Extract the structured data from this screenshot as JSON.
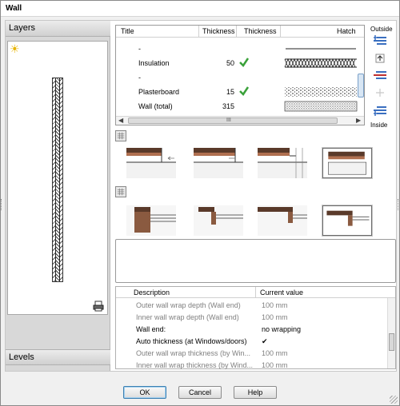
{
  "window": {
    "title": "Wall"
  },
  "left_panel": {
    "layers_header": "Layers",
    "levels_header": "Levels"
  },
  "layer_table": {
    "columns": [
      "Title",
      "Thickness",
      "Thickness",
      "Hatch"
    ],
    "rows": [
      {
        "title": "-",
        "thickness": "",
        "checked": false,
        "hatch": "line"
      },
      {
        "title": "Insulation",
        "thickness": "50",
        "checked": true,
        "hatch": "zigzag"
      },
      {
        "title": "-",
        "thickness": "",
        "checked": false,
        "hatch": "blank"
      },
      {
        "title": "Plasterboard",
        "thickness": "15",
        "checked": true,
        "hatch": "dots"
      },
      {
        "title": "Wall (total)",
        "thickness": "315",
        "checked": false,
        "hatch": "dense-dots"
      }
    ],
    "scroll_mid_label": "III"
  },
  "side_buttons": {
    "outside_label": "Outside",
    "inside_label": "Inside"
  },
  "properties": {
    "columns": [
      "Description",
      "Current value"
    ],
    "rows": [
      {
        "description": "Outer wall wrap depth (Wall end)",
        "value": "100 mm",
        "enabled": false
      },
      {
        "description": "Inner wall wrap depth (Wall end)",
        "value": "100 mm",
        "enabled": false
      },
      {
        "description": "Wall end:",
        "value": "no wrapping",
        "enabled": true
      },
      {
        "description": "Auto thickness (at Windows/doors)",
        "value": "✔",
        "enabled": true
      },
      {
        "description": "Outer wall wrap thickness (by Win...",
        "value": "100 mm",
        "enabled": false
      },
      {
        "description": "Inner wall wrap thickness (by Wind...",
        "value": "100 mm",
        "enabled": false
      }
    ]
  },
  "buttons": {
    "ok": "OK",
    "cancel": "Cancel",
    "help": "Help"
  },
  "colors": {
    "accent": "#3c7fb1",
    "check_green": "#3aa13a",
    "icon_blue": "#3a6fc0",
    "icon_red": "#c03030",
    "brick": "#5a3a2a"
  }
}
